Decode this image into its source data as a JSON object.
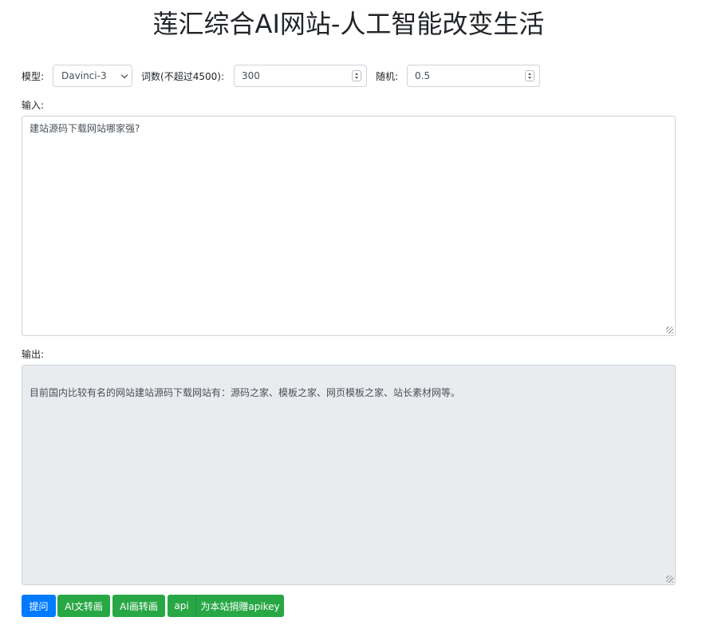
{
  "header": {
    "title": "莲汇综合AI网站-人工智能改变生活"
  },
  "settings": {
    "model_label": "模型:",
    "model_value": "Davinci-3",
    "words_label": "词数(不超过4500):",
    "words_value": "300",
    "random_label": "随机:",
    "random_value": "0.5"
  },
  "input": {
    "label": "输入:",
    "value": "建站源码下载网站哪家强?"
  },
  "output": {
    "label": "输出:",
    "value": "目前国内比较有名的网站建站源码下载网站有：源码之家、模板之家、网页模板之家、站长素材网等。"
  },
  "buttons": {
    "ask": "提问",
    "text_to_image": "AI文转画",
    "image_to_image": "AI画转画",
    "api": "api",
    "donate": "为本站捐赠apikey"
  },
  "colors": {
    "primary": "#007bff",
    "success": "#28a745",
    "output_bg": "#e9ecef",
    "border": "#ced4da"
  }
}
